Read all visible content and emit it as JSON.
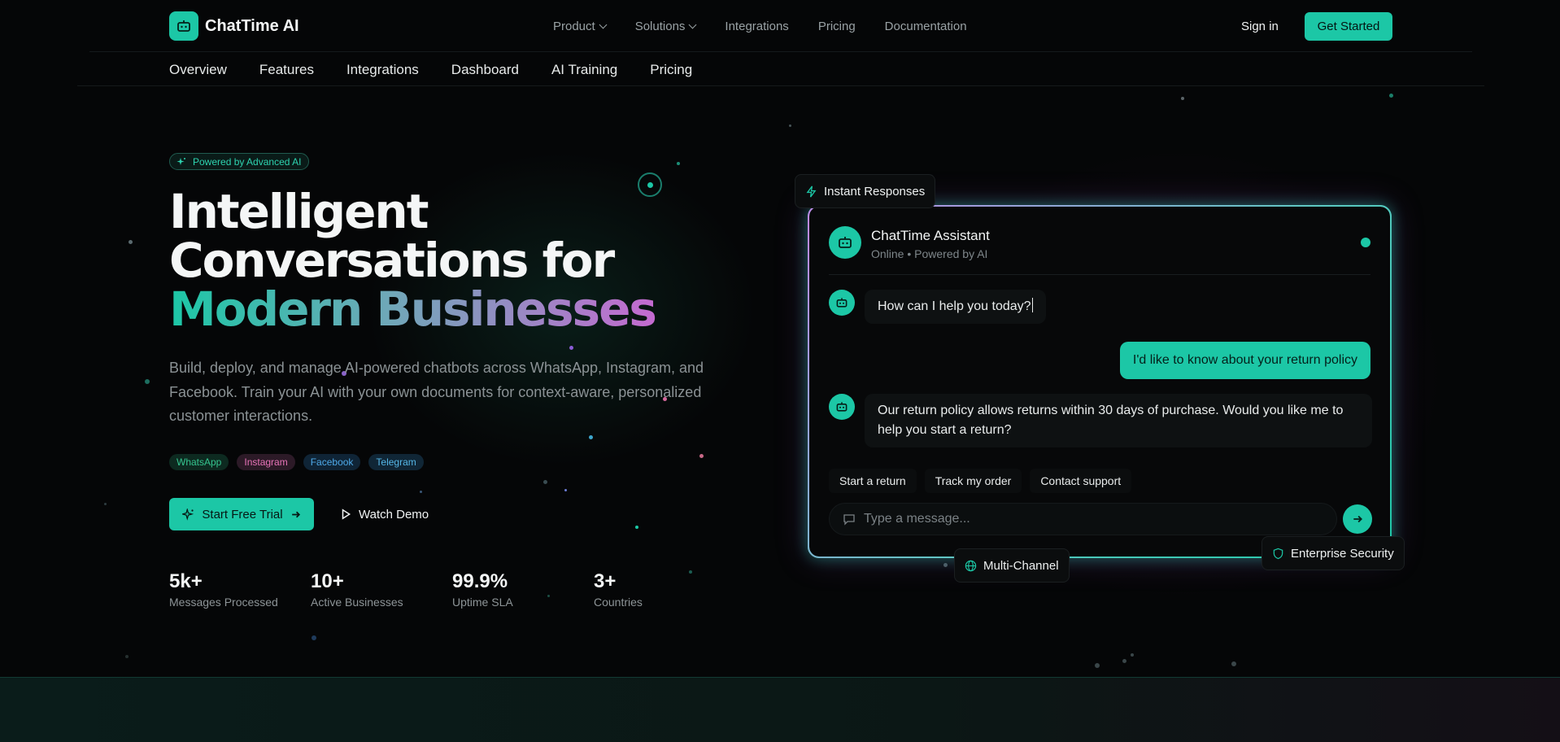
{
  "brand": {
    "name": "ChatTime AI",
    "accent": "#1cc7a6"
  },
  "topnav": {
    "links": [
      {
        "label": "Product",
        "dropdown": true
      },
      {
        "label": "Solutions",
        "dropdown": true
      },
      {
        "label": "Integrations",
        "dropdown": false
      },
      {
        "label": "Pricing",
        "dropdown": false
      },
      {
        "label": "Documentation",
        "dropdown": false
      }
    ],
    "signin": "Sign in",
    "get_started": "Get Started"
  },
  "subnav": [
    "Overview",
    "Features",
    "Integrations",
    "Dashboard",
    "AI Training",
    "Pricing"
  ],
  "hero": {
    "badge": "Powered by Advanced AI",
    "title_line1": "Intelligent",
    "title_line2": "Conversations for",
    "title_line3": "Modern Businesses",
    "description": "Build, deploy, and manage AI-powered chatbots across WhatsApp, Instagram, and Facebook. Train your AI with your own documents for context-aware, personalized customer interactions.",
    "channels": [
      "WhatsApp",
      "Instagram",
      "Facebook",
      "Telegram"
    ],
    "cta_primary": "Start Free Trial",
    "cta_secondary": "Watch Demo",
    "stats": [
      {
        "value": "5k+",
        "label": "Messages Processed"
      },
      {
        "value": "10+",
        "label": "Active Businesses"
      },
      {
        "value": "99.9%",
        "label": "Uptime SLA"
      },
      {
        "value": "3+",
        "label": "Countries"
      }
    ]
  },
  "chat": {
    "assistant_name": "ChatTime Assistant",
    "status": "Online • Powered by AI",
    "messages": [
      {
        "from": "bot",
        "text": "How can I help you today?"
      },
      {
        "from": "user",
        "text": "I'd like to know about your return policy"
      },
      {
        "from": "bot",
        "text": "Our return policy allows returns within 30 days of purchase. Would you like me to help you start a return?"
      }
    ],
    "quick_replies": [
      "Start a return",
      "Track my order",
      "Contact support"
    ],
    "input_placeholder": "Type a message..."
  },
  "floating_badges": {
    "instant": "Instant Responses",
    "multichannel": "Multi-Channel",
    "security": "Enterprise Security"
  }
}
